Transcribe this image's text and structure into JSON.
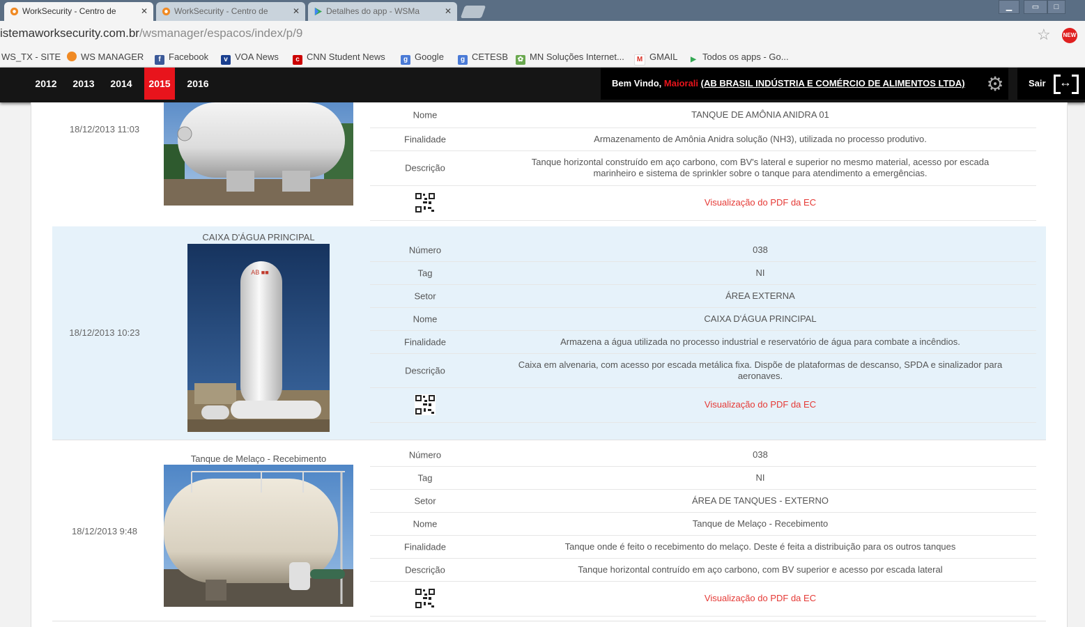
{
  "browser": {
    "tabs": [
      {
        "label": "WorkSecurity - Centro de",
        "active": true
      },
      {
        "label": "WorkSecurity - Centro de",
        "active": false
      },
      {
        "label": "Detalhes do app - WSMa",
        "active": false
      }
    ],
    "url_host": "istemaworksecurity.com.br",
    "url_path": "/wsmanager/espacos/index/p/9",
    "ext_badge": "NEW",
    "bookmarks": [
      {
        "label": "WS_TX - SITE",
        "icon": ""
      },
      {
        "label": "WS MANAGER",
        "icon": "ws-manager-icon"
      },
      {
        "label": "Facebook",
        "icon": "facebook-icon"
      },
      {
        "label": "VOA News",
        "icon": "voa-icon"
      },
      {
        "label": "CNN Student News",
        "icon": "cnn-icon"
      },
      {
        "label": "Google",
        "icon": "google-icon"
      },
      {
        "label": "CETESB",
        "icon": "cetesb-icon"
      },
      {
        "label": "MN Soluções Internet...",
        "icon": "mn-icon"
      },
      {
        "label": "GMAIL",
        "icon": "gmail-icon"
      },
      {
        "label": "Todos os apps - Go...",
        "icon": "apps-icon"
      }
    ]
  },
  "nav": {
    "years": [
      "2012",
      "2013",
      "2014",
      "2015",
      "2016"
    ],
    "active_year": "2015",
    "welcome_prefix": "Bem Vindo,",
    "user": "Maiorali",
    "company": "(AB BRASIL INDÚSTRIA E COMÉRCIO DE ALIMENTOS LTDA)",
    "logout": "Sair"
  },
  "records": [
    {
      "date": "18/12/2013 11:03",
      "title": "",
      "fields": [
        {
          "label": "Nome",
          "value": "TANQUE DE AMÔNIA ANIDRA 01"
        },
        {
          "label": "Finalidade",
          "value": "Armazenamento de Amônia Anidra solução (NH3), utilizada no processo produtivo."
        },
        {
          "label": "Descrição",
          "value": "Tanque horizontal construído em aço carbono, com BV's lateral e superior no mesmo material, acesso por escada marinheiro e sistema de sprinkler sobre o tanque para atendimento a emergências."
        }
      ],
      "pdf_link": "Visualização do PDF da EC"
    },
    {
      "date": "18/12/2013 10:23",
      "title": "CAIXA D'ÁGUA PRINCIPAL",
      "fields": [
        {
          "label": "Número",
          "value": "038"
        },
        {
          "label": "Tag",
          "value": "NI"
        },
        {
          "label": "Setor",
          "value": "ÁREA EXTERNA"
        },
        {
          "label": "Nome",
          "value": "CAIXA D'ÁGUA PRINCIPAL"
        },
        {
          "label": "Finalidade",
          "value": "Armazena a água utilizada no processo industrial e reservatório de água para combate a incêndios."
        },
        {
          "label": "Descrição",
          "value": "Caixa em alvenaria, com acesso por escada metálica fixa. Dispõe de plataformas de descanso, SPDA e sinalizador para aeronaves."
        }
      ],
      "pdf_link": "Visualização do PDF da EC"
    },
    {
      "date": "18/12/2013 9:48",
      "title": "Tanque de Melaço - Recebimento",
      "fields": [
        {
          "label": "Número",
          "value": "038"
        },
        {
          "label": "Tag",
          "value": "NI"
        },
        {
          "label": "Setor",
          "value": "ÁREA DE TANQUES - EXTERNO"
        },
        {
          "label": "Nome",
          "value": "Tanque de Melaço - Recebimento"
        },
        {
          "label": "Finalidade",
          "value": "Tanque onde é feito o recebimento do melaço. Deste é feita a distribuição para os outros tanques"
        },
        {
          "label": "Descrição",
          "value": "Tanque horizontal contruído em aço carbono, com BV superior e acesso por escada lateral"
        }
      ],
      "pdf_link": "Visualização do PDF da EC"
    }
  ],
  "colors": {
    "accent": "#e8141c",
    "nav_bg": "#151515",
    "highlight_row": "#e6f2fa",
    "pdf_link": "#e53935"
  }
}
